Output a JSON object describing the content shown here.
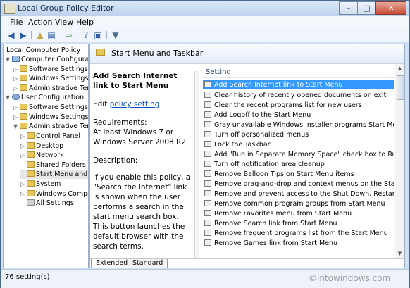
{
  "window": {
    "title": "Local Group Policy Editor"
  },
  "menu": [
    "File",
    "Action",
    "View",
    "Help"
  ],
  "toolbar": [
    "back-icon",
    "forward-icon",
    "up-folder-icon",
    "show-hide-tree-icon",
    "export-list-icon",
    "help-icon",
    "properties-icon",
    "filter-icon"
  ],
  "tree": [
    {
      "label": "Local Computer Policy",
      "depth": 0
    },
    {
      "label": "Computer Configuration",
      "depth": 1,
      "icon": "computer"
    },
    {
      "label": "Software Settings",
      "depth": 2,
      "icon": "folder"
    },
    {
      "label": "Windows Settings",
      "depth": 2,
      "icon": "folder"
    },
    {
      "label": "Administrative Temp",
      "depth": 2,
      "icon": "folder"
    },
    {
      "label": "User Configuration",
      "depth": 1,
      "icon": "user"
    },
    {
      "label": "Software Settings",
      "depth": 2,
      "icon": "folder"
    },
    {
      "label": "Windows Settings",
      "depth": 2,
      "icon": "folder"
    },
    {
      "label": "Administrative Temp",
      "depth": 2,
      "icon": "folder"
    },
    {
      "label": "Control Panel",
      "depth": 3,
      "icon": "folder"
    },
    {
      "label": "Desktop",
      "depth": 3,
      "icon": "folder"
    },
    {
      "label": "Network",
      "depth": 3,
      "icon": "folder"
    },
    {
      "label": "Shared Folders",
      "depth": 3,
      "icon": "folder"
    },
    {
      "label": "Start Menu and T",
      "depth": 3,
      "icon": "folder",
      "selected": true
    },
    {
      "label": "System",
      "depth": 3,
      "icon": "folder"
    },
    {
      "label": "Windows Compo",
      "depth": 3,
      "icon": "folder"
    },
    {
      "label": "All Settings",
      "depth": 3,
      "icon": "settings"
    }
  ],
  "header": {
    "title": "Start Menu and Taskbar"
  },
  "description": {
    "title": "Add Search Internet link to Start Menu",
    "edit_prefix": "Edit",
    "edit_link": "policy setting",
    "requirements_label": "Requirements:",
    "requirements_text": "At least Windows 7 or Windows Server 2008 R2",
    "description_label": "Description:",
    "description_text": "If you enable this policy, a \"Search the Internet\" link is shown when the user performs a search in the start menu search box.  This button launches the default browser with the search terms."
  },
  "list": {
    "column": "Setting",
    "items": [
      "Add Search Internet link to Start Menu",
      "Clear history of recently opened documents on exit",
      "Clear the recent programs list for new users",
      "Add Logoff to the Start Menu",
      "Gray unavailable Windows Installer programs Start Menu sh...",
      "Turn off personalized menus",
      "Lock the Taskbar",
      "Add \"Run in Separate Memory Space\" check box to Run dial...",
      "Turn off notification area cleanup",
      "Remove Balloon Tips on Start Menu items",
      "Remove drag-and-drop and context menus on the Start Men...",
      "Remove and prevent access to the Shut Down, Restart, Sleep...",
      "Remove common program groups from Start Menu",
      "Remove Favorites menu from Start Menu",
      "Remove Search link from Start Menu",
      "Remove frequent programs list from the Start Menu",
      "Remove Games link from Start Menu"
    ]
  },
  "tabs": [
    "Extended",
    "Standard"
  ],
  "status": {
    "text": "76 setting(s)"
  },
  "watermark": "©intowindows.com"
}
